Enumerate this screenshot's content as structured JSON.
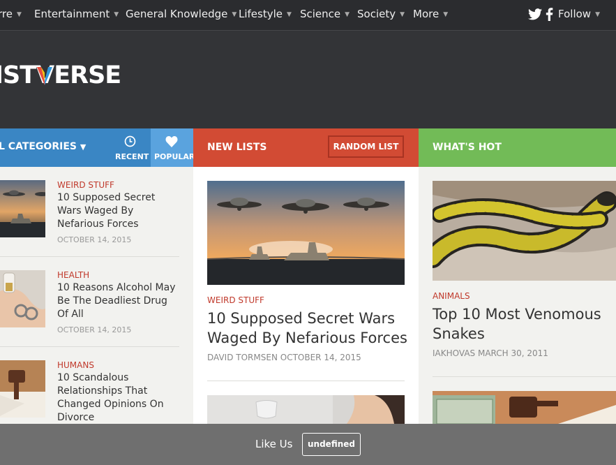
{
  "topnav": {
    "items": [
      "rre",
      "Entertainment",
      "General Knowledge",
      "Lifestyle",
      "Science",
      "Society",
      "More"
    ],
    "follow_label": "Follow",
    "twitter_icon": "twitter-icon",
    "facebook_icon": "facebook-icon"
  },
  "logo": {
    "text_pre": "IST",
    "text_v": "V",
    "text_post": "ERSE"
  },
  "tabs": {
    "categories": "L CATEGORIES",
    "recent": "RECENT",
    "popular": "POPULAR",
    "new_lists": "NEW LISTS",
    "random_list": "RANDOM LIST",
    "whats_hot": "WHAT'S HOT"
  },
  "sidebar": {
    "items": [
      {
        "category": "WEIRD STUFF",
        "title": "10 Supposed Secret Wars Waged By Nefarious Forces",
        "date": "OCTOBER 14, 2015"
      },
      {
        "category": "HEALTH",
        "title": "10 Reasons Alcohol May Be The Deadliest Drug Of All",
        "date": "OCTOBER 14, 2015"
      },
      {
        "category": "HUMANS",
        "title": "10 Scandalous Relationships That Changed Opinions On Divorce",
        "date": ""
      }
    ]
  },
  "new_lists": {
    "category": "WEIRD STUFF",
    "title": "10 Supposed Secret Wars Waged By Nefarious Forces",
    "author": "DAVID TORMSEN",
    "date": "OCTOBER 14, 2015"
  },
  "whats_hot": {
    "category": "ANIMALS",
    "title": "Top 10 Most Venomous Snakes",
    "author": "IAKHOVAS",
    "date": "MARCH 30, 2011"
  },
  "footer": {
    "like_label": "Like Us",
    "button_label": "undefined"
  },
  "colors": {
    "blue": "#3a86c4",
    "red": "#d24b34",
    "green": "#72bb57",
    "category": "#c0392b"
  }
}
